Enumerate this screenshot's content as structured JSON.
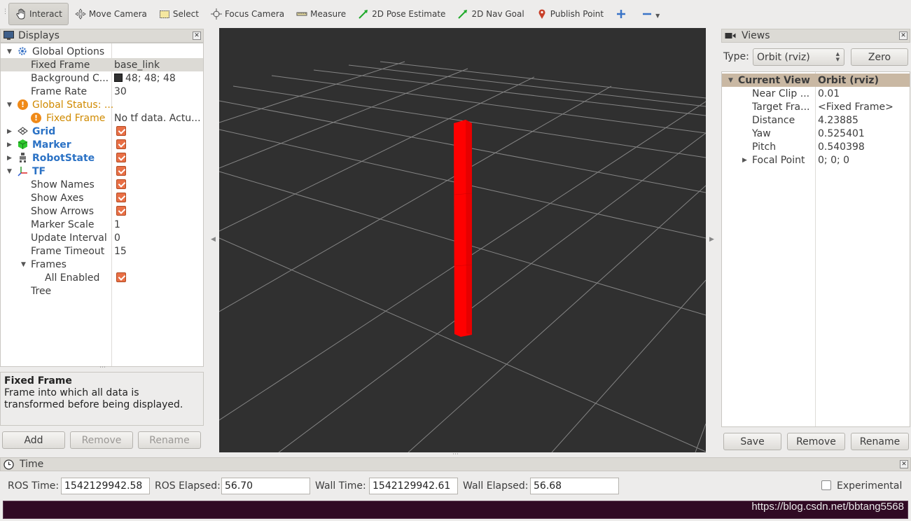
{
  "toolbar": {
    "tools": [
      {
        "label": "Interact",
        "icon": "hand-pointer-icon",
        "active": true
      },
      {
        "label": "Move Camera",
        "icon": "move-camera-icon"
      },
      {
        "label": "Select",
        "icon": "select-rect-icon"
      },
      {
        "label": "Focus Camera",
        "icon": "focus-target-icon"
      },
      {
        "label": "Measure",
        "icon": "ruler-icon"
      },
      {
        "label": "2D Pose Estimate",
        "icon": "green-arrow-icon"
      },
      {
        "label": "2D Nav Goal",
        "icon": "green-arrow-icon"
      },
      {
        "label": "Publish Point",
        "icon": "map-pin-icon"
      }
    ]
  },
  "displays": {
    "title": "Displays",
    "rows": {
      "global_options": "Global Options",
      "fixed_frame": {
        "name": "Fixed Frame",
        "value": "base_link"
      },
      "background": {
        "name": "Background C...",
        "value": "48; 48; 48"
      },
      "frame_rate": {
        "name": "Frame Rate",
        "value": "30"
      },
      "global_status": "Global Status: ...",
      "status_fixed_frame": {
        "name": "Fixed Frame",
        "value": "No tf data.  Actu..."
      },
      "grid": "Grid",
      "marker": "Marker",
      "robot_state": "RobotState",
      "tf": "TF",
      "show_names": "Show Names",
      "show_axes": "Show Axes",
      "show_arrows": "Show Arrows",
      "marker_scale": {
        "name": "Marker Scale",
        "value": "1"
      },
      "update_interval": {
        "name": "Update Interval",
        "value": "0"
      },
      "frame_timeout": {
        "name": "Frame Timeout",
        "value": "15"
      },
      "frames": "Frames",
      "all_enabled": "All Enabled",
      "tree": "Tree"
    },
    "help": {
      "title": "Fixed Frame",
      "text": "Frame into which all data is transformed before being displayed."
    },
    "buttons": {
      "add": "Add",
      "remove": "Remove",
      "rename": "Rename"
    }
  },
  "views": {
    "title": "Views",
    "type_label": "Type:",
    "type_value": "Orbit (rviz)",
    "zero": "Zero",
    "header": {
      "name": "Current View",
      "value": "Orbit (rviz)"
    },
    "rows": [
      {
        "name": "Near Clip ...",
        "value": "0.01"
      },
      {
        "name": "Target Fra...",
        "value": "<Fixed Frame>"
      },
      {
        "name": "Distance",
        "value": "4.23885"
      },
      {
        "name": "Yaw",
        "value": "0.525401"
      },
      {
        "name": "Pitch",
        "value": "0.540398"
      },
      {
        "name": "Focal Point",
        "value": "0; 0; 0"
      }
    ],
    "buttons": {
      "save": "Save",
      "remove": "Remove",
      "rename": "Rename"
    }
  },
  "time": {
    "title": "Time",
    "ros_time_label": "ROS Time:",
    "ros_time": "1542129942.58",
    "ros_elapsed_label": "ROS Elapsed:",
    "ros_elapsed": "56.70",
    "wall_time_label": "Wall Time:",
    "wall_time": "1542129942.61",
    "wall_elapsed_label": "Wall Elapsed:",
    "wall_elapsed": "56.68",
    "experimental": "Experimental"
  },
  "watermark": "https://blog.csdn.net/bbtang5568",
  "colors": {
    "viewport_bg": "#303030",
    "marker": "#ff0000",
    "checkbox": "#e96f45",
    "accent_blue": "#2b72c5"
  }
}
